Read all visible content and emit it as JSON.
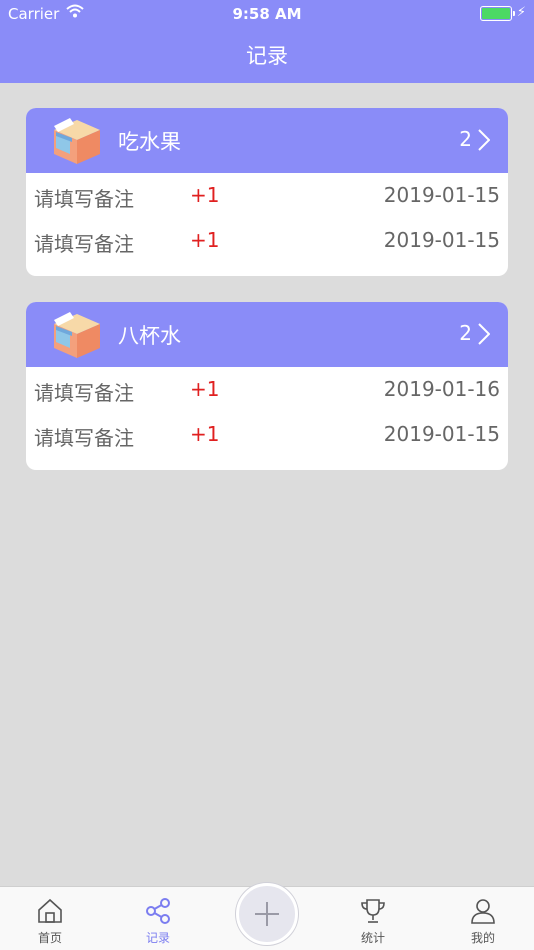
{
  "status_bar": {
    "carrier": "Carrier",
    "time": "9:58 AM"
  },
  "nav": {
    "title": "记录"
  },
  "cards": [
    {
      "name": "吃水果",
      "count": "2",
      "rows": [
        {
          "note": "请填写备注",
          "delta": "+1",
          "date": "2019-01-15"
        },
        {
          "note": "请填写备注",
          "delta": "+1",
          "date": "2019-01-15"
        }
      ]
    },
    {
      "name": "八杯水",
      "count": "2",
      "rows": [
        {
          "note": "请填写备注",
          "delta": "+1",
          "date": "2019-01-16"
        },
        {
          "note": "请填写备注",
          "delta": "+1",
          "date": "2019-01-15"
        }
      ]
    }
  ],
  "tabbar": {
    "home": "首页",
    "records": "记录",
    "stats": "统计",
    "mine": "我的"
  },
  "colors": {
    "accent": "#8a8cf8",
    "delta": "#e02020",
    "background": "#dcdcdc"
  },
  "icons": [
    "wifi-icon",
    "battery-icon",
    "shop-icon",
    "chevron-right-icon",
    "home-icon",
    "share-icon",
    "plus-icon",
    "trophy-icon",
    "user-icon"
  ]
}
